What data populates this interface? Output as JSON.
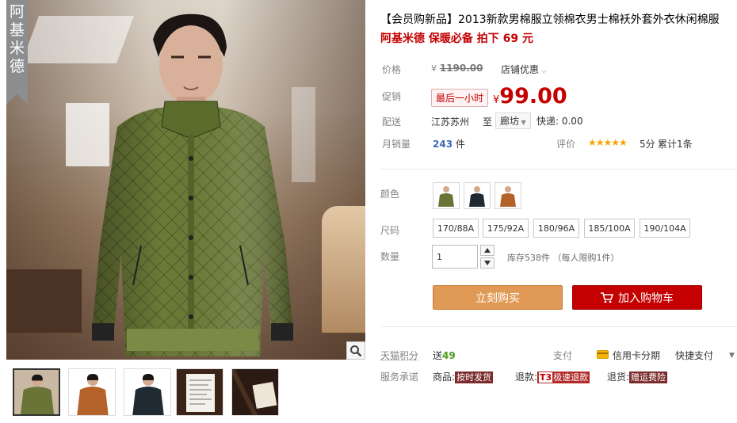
{
  "gallery": {
    "brand_banner": "阿基米德",
    "thumbnails": [
      {
        "color": "olive"
      },
      {
        "color": "brown"
      },
      {
        "color": "navy"
      },
      {
        "color": "tag"
      },
      {
        "color": "label"
      }
    ],
    "accent_olive": "#6b7437",
    "accent_brown": "#b5622a",
    "accent_navy": "#1f2a32"
  },
  "product": {
    "title": "【会员购新品】2013新款男棉服立领棉衣男士棉袄外套外衣休闲棉服",
    "subtitle": "阿基米德 保暖必备 拍下 69 元"
  },
  "price": {
    "label": "价格",
    "yen": "¥",
    "original": "1190.00",
    "shop_promo": "店铺优惠",
    "promo_label": "促销",
    "promo_badge": "最后一小时",
    "promo_yen": "¥",
    "promo_value": "99.00",
    "ship_label": "配送",
    "ship_from": "江苏苏州",
    "ship_to": "至",
    "ship_dest": "廊坊",
    "ship_fee": "快递: 0.00",
    "sales_label": "月销量",
    "sales_value": "243",
    "sales_unit": "件",
    "rating_label": "评价",
    "stars": "★★★★★",
    "score": "5分",
    "review_count": "累计1条"
  },
  "options": {
    "color_label": "颜色",
    "size_label": "尺码",
    "sizes": [
      "170/88A",
      "175/92A",
      "180/96A",
      "185/100A",
      "190/104A"
    ],
    "qty_label": "数量",
    "qty_value": "1",
    "stock": "库存538件 （每人限购1件）"
  },
  "actions": {
    "buy_now": "立刻购买",
    "add_cart": "加入购物车"
  },
  "extras": {
    "points_label": "天猫积分",
    "points_prefix": "送",
    "points_value": "49",
    "pay_label": "支付",
    "credit": "信用卡分期",
    "express_pay": "快捷支付",
    "service_label": "服务承诺",
    "svc_goods_prefix": "商品:",
    "svc_goods_tag": "按时发货",
    "svc_refund_prefix": "退款:",
    "svc_refund_t3": "T3",
    "svc_refund_tag": "极速退款",
    "svc_return_prefix": "退货:",
    "svc_return_tag": "赠运费险"
  }
}
